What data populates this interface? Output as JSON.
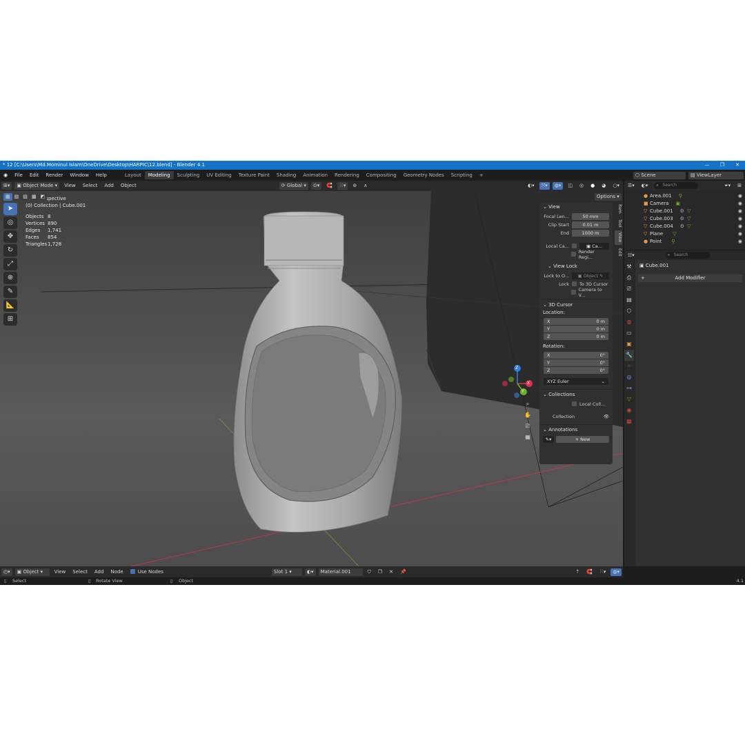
{
  "window": {
    "title": "* 12 [C:\\Users\\Md.Mominul Islam\\OneDrive\\Desktop\\HARPIC\\12.blend] - Blender 4.1"
  },
  "menus": [
    "File",
    "Edit",
    "Render",
    "Window",
    "Help"
  ],
  "workspaces": [
    "Layout",
    "Modeling",
    "Sculpting",
    "UV Editing",
    "Texture Paint",
    "Shading",
    "Animation",
    "Rendering",
    "Compositing",
    "Geometry Nodes",
    "Scripting"
  ],
  "active_workspace": "Modeling",
  "scene": {
    "name": "Scene",
    "view_layer": "ViewLayer"
  },
  "header": {
    "mode": "Object Mode",
    "menus": [
      "View",
      "Select",
      "Add",
      "Object"
    ],
    "transform_orientation": "Global",
    "options_label": "Options"
  },
  "viewport": {
    "perspective": "User Perspective",
    "collection_info": "(0) Collection | Cube.001",
    "stats": [
      {
        "label": "Objects",
        "value": "8"
      },
      {
        "label": "Vertices",
        "value": "890"
      },
      {
        "label": "Edges",
        "value": "1,741"
      },
      {
        "label": "Faces",
        "value": "854"
      },
      {
        "label": "Triangles",
        "value": "1,728"
      }
    ],
    "gizmo": {
      "x": "X",
      "y": "Y",
      "z": "Z"
    }
  },
  "npanel": {
    "view_header": "View",
    "focal_label": "Focal Len...",
    "focal_value": "50 mm",
    "clip_start_label": "Clip Start",
    "clip_start_value": "0.01 m",
    "end_label": "End",
    "end_value": "1000 m",
    "local_camera_label": "Local Ca...",
    "local_camera_value": "Ca...",
    "render_region_label": "Render Regi...",
    "view_lock_header": "View Lock",
    "lock_to_label": "Lock to O...",
    "lock_to_value": "Object",
    "lock_label": "Lock",
    "to_3d_cursor_label": "To 3D Cursor",
    "camera_to_view_label": "Camera to V...",
    "cursor_header": "3D Cursor",
    "location_label": "Location:",
    "location": [
      {
        "axis": "X",
        "value": "0 m"
      },
      {
        "axis": "Y",
        "value": "0 m"
      },
      {
        "axis": "Z",
        "value": "0 m"
      }
    ],
    "rotation_label": "Rotation:",
    "rotation": [
      {
        "axis": "X",
        "value": "0°"
      },
      {
        "axis": "Y",
        "value": "0°"
      },
      {
        "axis": "Z",
        "value": "0°"
      }
    ],
    "rotation_mode": "XYZ Euler",
    "collections_header": "Collections",
    "local_collections_label": "Local Coll...",
    "collection_label": "Collection",
    "annotations_header": "Annotations",
    "new_label": "New",
    "tabs": [
      "Item",
      "Tool",
      "View",
      "Edit"
    ]
  },
  "outliner": {
    "search_placeholder": "Search",
    "items": [
      {
        "name": "Area.001"
      },
      {
        "name": "Camera"
      },
      {
        "name": "Cube.001"
      },
      {
        "name": "Cube.003"
      },
      {
        "name": "Cube.004"
      },
      {
        "name": "Plane"
      },
      {
        "name": "Point"
      }
    ]
  },
  "properties": {
    "search_placeholder": "Search",
    "object_name": "Cube.001",
    "add_modifier_label": "Add Modifier"
  },
  "footer": {
    "editor_mode": "Object",
    "menus": [
      "View",
      "Select",
      "Add",
      "Node"
    ],
    "use_nodes_label": "Use Nodes",
    "slot_label": "Slot 1",
    "material_name": "Material.001"
  },
  "status": {
    "select_label": "Select",
    "rotate_label": "Rotate View",
    "object_label": "Object",
    "version_fragment": "4.1"
  },
  "colors": {
    "titlebar": "#1573c7",
    "accent_blue": "#4772b3",
    "axis_x": "#e0304a",
    "axis_y": "#6cb02c",
    "axis_z": "#2f7fd8"
  }
}
